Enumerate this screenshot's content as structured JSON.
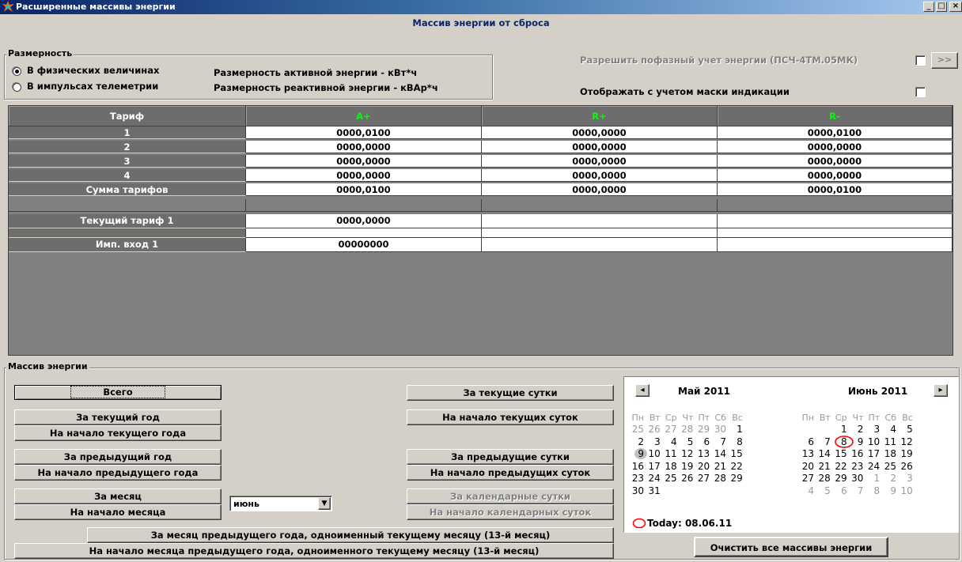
{
  "window": {
    "title": "Расширенные массивы энергии",
    "minimize": "_",
    "maximize": "□",
    "close": "×"
  },
  "header": {
    "title": "Массив энергии от сброса"
  },
  "dimension": {
    "legend": "Размерность",
    "options": [
      {
        "label": "В физических величинах",
        "selected": true
      },
      {
        "label": "В импульсах телеметрии",
        "selected": false
      }
    ],
    "active_units": "Размерность активной энергии - кВт*ч",
    "reactive_units": "Размерность реактивной энергии - кВАр*ч"
  },
  "phase": {
    "label": "Разрешить  пофазный учет энергии (ПСЧ-4ТМ.05МК)",
    "button": ">>"
  },
  "mask": {
    "label": "Отображать с учетом маски индикации"
  },
  "table": {
    "headers": [
      "Тариф",
      "A+",
      "R+",
      "R-"
    ],
    "header_colors": {
      "A+": "#00ff00",
      "R+": "#00ff00",
      "R-": "#00ff00"
    },
    "rows": [
      {
        "label": "1",
        "values": [
          "0000,0100",
          "0000,0000",
          "0000,0100"
        ]
      },
      {
        "label": "2",
        "values": [
          "0000,0000",
          "0000,0000",
          "0000,0000"
        ]
      },
      {
        "label": "3",
        "values": [
          "0000,0000",
          "0000,0000",
          "0000,0000"
        ]
      },
      {
        "label": "4",
        "values": [
          "0000,0000",
          "0000,0000",
          "0000,0000"
        ]
      },
      {
        "label": "Сумма тарифов",
        "values": [
          "0000,0100",
          "0000,0000",
          "0000,0100"
        ]
      }
    ],
    "current_tariff": {
      "label": "Текущий тариф 1",
      "values": [
        "0000,0000",
        "",
        ""
      ]
    },
    "imp_input": {
      "label": "Имп. вход 1",
      "values": [
        "00000000",
        "",
        ""
      ]
    }
  },
  "energy": {
    "legend": "Массив энергии",
    "total": "Всего",
    "current_year": "За текущий год",
    "start_current_year": "На начало текущего года",
    "prev_year": "За предыдущий год",
    "start_prev_year": "На начало предыдущего года",
    "month": "За месяц",
    "start_month": "На начало месяца",
    "month_select": "июнь",
    "current_day": "За текущие сутки",
    "start_current_day": "На начало текущих суток",
    "prev_day": "За предыдущие сутки",
    "start_prev_day": "На начало предыдущих суток",
    "calendar_day": "За календарные сутки",
    "start_calendar_day": "На начало календарных суток",
    "month_13": "За месяц предыдущего года, одноименный текущему месяцу (13-й месяц)",
    "start_month_13": "На начало месяца предыдущего года, одноименного текущему месяцу (13-й месяц)",
    "clear_all": "Очистить все массивы энергии"
  },
  "calendar": {
    "prev_arrow": "◂",
    "next_arrow": "▸",
    "weekdays": [
      "Пн",
      "Вт",
      "Ср",
      "Чт",
      "Пт",
      "Сб",
      "Вс"
    ],
    "months": [
      {
        "title": "Май 2011",
        "weeks": [
          [
            "25",
            "26",
            "27",
            "28",
            "29",
            "30",
            "1"
          ],
          [
            "2",
            "3",
            "4",
            "5",
            "6",
            "7",
            "8"
          ],
          [
            "9",
            "10",
            "11",
            "12",
            "13",
            "14",
            "15"
          ],
          [
            "16",
            "17",
            "18",
            "19",
            "20",
            "21",
            "22"
          ],
          [
            "23",
            "24",
            "25",
            "26",
            "27",
            "28",
            "29"
          ],
          [
            "30",
            "31",
            "",
            "",
            "",
            "",
            ""
          ]
        ],
        "other": [
          [
            1,
            1,
            1,
            1,
            1,
            1,
            0
          ],
          [
            0,
            0,
            0,
            0,
            0,
            0,
            0
          ],
          [
            0,
            0,
            0,
            0,
            0,
            0,
            0
          ],
          [
            0,
            0,
            0,
            0,
            0,
            0,
            0
          ],
          [
            0,
            0,
            0,
            0,
            0,
            0,
            0
          ],
          [
            0,
            0,
            0,
            0,
            0,
            0,
            0
          ]
        ]
      },
      {
        "title": "Июнь 2011",
        "weeks": [
          [
            "",
            "",
            "1",
            "2",
            "3",
            "4",
            "5"
          ],
          [
            "6",
            "7",
            "8",
            "9",
            "10",
            "11",
            "12"
          ],
          [
            "13",
            "14",
            "15",
            "16",
            "17",
            "18",
            "19"
          ],
          [
            "20",
            "21",
            "22",
            "23",
            "24",
            "25",
            "26"
          ],
          [
            "27",
            "28",
            "29",
            "30",
            "1",
            "2",
            "3"
          ],
          [
            "4",
            "5",
            "6",
            "7",
            "8",
            "9",
            "10"
          ]
        ],
        "other": [
          [
            0,
            0,
            0,
            0,
            0,
            0,
            0
          ],
          [
            0,
            0,
            0,
            0,
            0,
            0,
            0
          ],
          [
            0,
            0,
            0,
            0,
            0,
            0,
            0
          ],
          [
            0,
            0,
            0,
            0,
            0,
            0,
            0
          ],
          [
            0,
            0,
            0,
            0,
            1,
            1,
            1
          ],
          [
            1,
            1,
            1,
            1,
            1,
            1,
            1
          ]
        ]
      }
    ],
    "today_label": "Today: 08.06.11",
    "today_color": "#ff0000"
  }
}
